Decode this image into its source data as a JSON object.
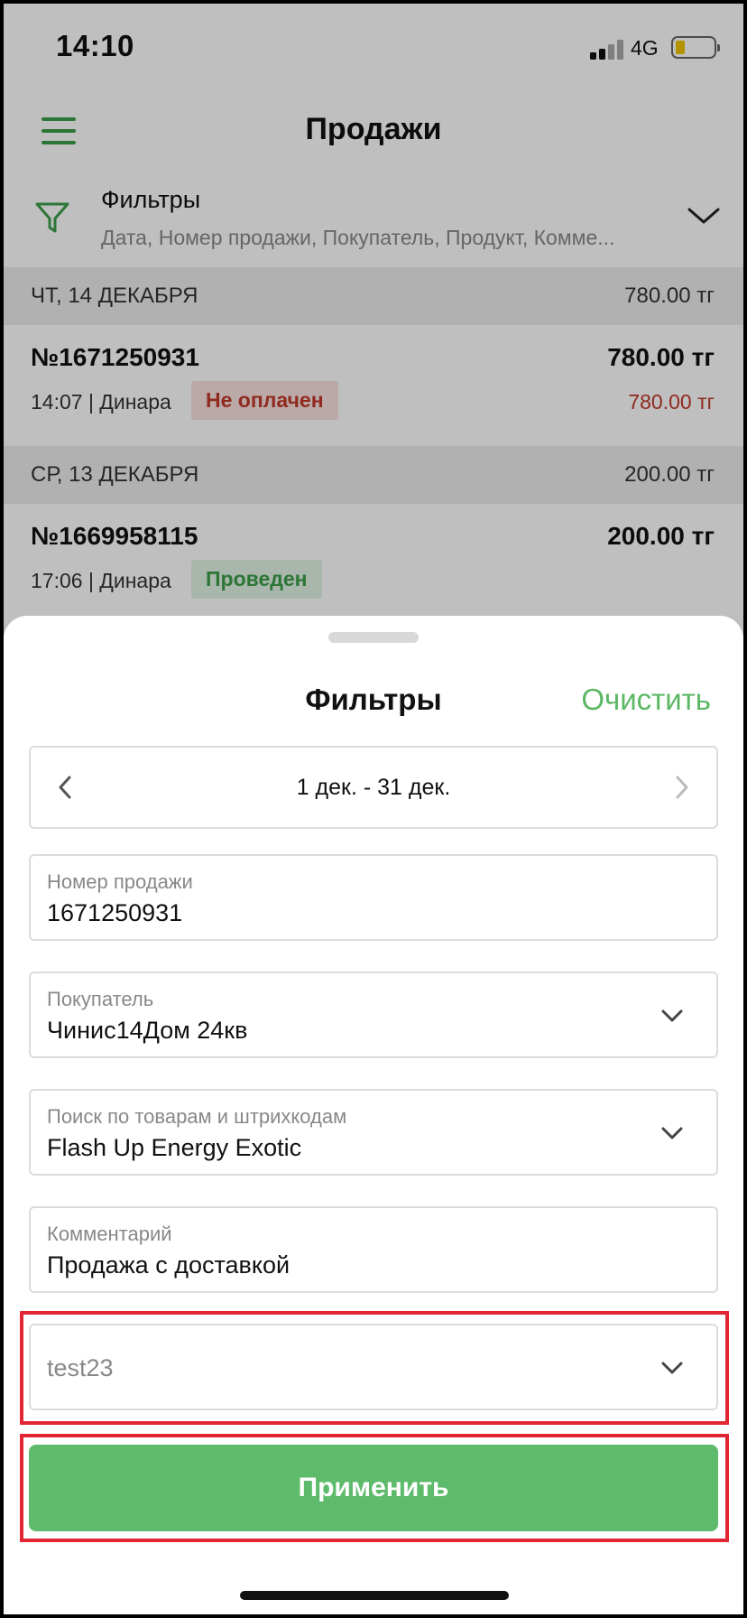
{
  "status_bar": {
    "time": "14:10",
    "network": "4G"
  },
  "nav": {
    "title": "Продажи"
  },
  "filter_bar": {
    "title": "Фильтры",
    "subtitle": "Дата, Номер продажи, Покупатель, Продукт, Комме..."
  },
  "days": [
    {
      "date": "ЧТ, 14 ДЕКАБРЯ",
      "total": "780.00 тг",
      "sales": [
        {
          "number": "№1671250931",
          "amount": "780.00 тг",
          "meta": "14:07 | Динара",
          "status": "Не оплачен",
          "debt": "780.00 тг"
        }
      ]
    },
    {
      "date": "СР, 13 ДЕКАБРЯ",
      "total": "200.00 тг",
      "sales": [
        {
          "number": "№1669958115",
          "amount": "200.00 тг",
          "meta": "17:06 | Динара",
          "status": "Проведен"
        }
      ]
    }
  ],
  "sheet": {
    "title": "Фильтры",
    "clear_label": "Очистить",
    "date_range": "1 дек. - 31 дек.",
    "fields": {
      "sale_number": {
        "label": "Номер продажи",
        "value": "1671250931"
      },
      "buyer": {
        "label": "Покупатель",
        "value": "Чинис14Дом 24кв"
      },
      "product": {
        "label": "Поиск по товарам и штрихкодам",
        "value": "Flash Up Energy Exotic"
      },
      "comment": {
        "label": "Комментарий",
        "value": "Продажа с доставкой"
      },
      "extra": {
        "placeholder": "test23"
      }
    },
    "apply_label": "Применить"
  },
  "colors": {
    "accent": "#5dbb6b",
    "danger": "#c0392b",
    "highlight": "#e32634"
  }
}
